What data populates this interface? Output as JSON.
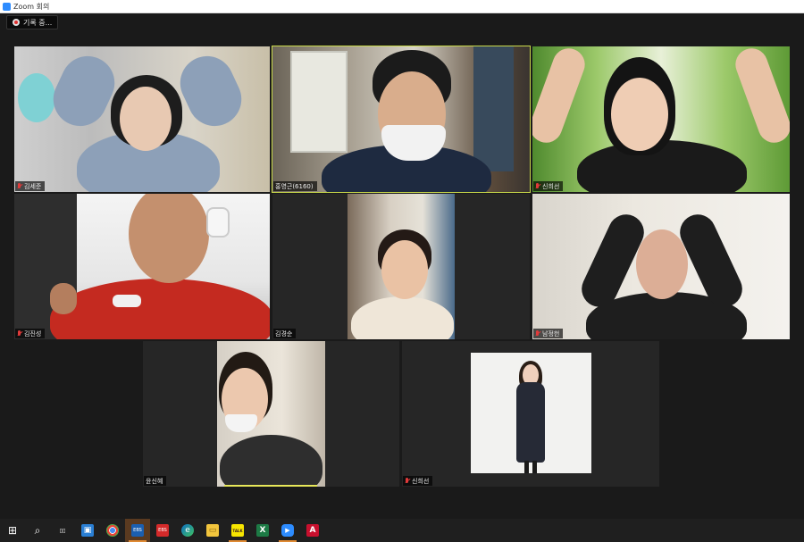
{
  "window": {
    "title": "Zoom 회의"
  },
  "recording": {
    "label": "기록 중..."
  },
  "participants": [
    {
      "name": "김세준",
      "muted": true
    },
    {
      "name": "홍영근(6160)",
      "muted": false,
      "active_speaker": true
    },
    {
      "name": "신희선",
      "muted": true
    },
    {
      "name": "김진성",
      "muted": true
    },
    {
      "name": "김경순",
      "muted": false
    },
    {
      "name": "남정헌",
      "muted": true
    },
    {
      "name": "윤신혜",
      "muted": false
    },
    {
      "name": "신희선",
      "muted": true
    }
  ],
  "taskbar": {
    "items": [
      {
        "name": "start-icon",
        "glyph": "⊞"
      },
      {
        "name": "search-icon",
        "glyph": "⌕"
      },
      {
        "name": "task-view-icon",
        "glyph": "▯▯"
      },
      {
        "name": "app-blue-icon",
        "glyph": "▣"
      },
      {
        "name": "chrome-icon",
        "glyph": "◉"
      },
      {
        "name": "app-orange-icon",
        "glyph": "EBS"
      },
      {
        "name": "app-red-icon",
        "glyph": "EBS"
      },
      {
        "name": "edge-icon",
        "glyph": "e"
      },
      {
        "name": "file-explorer-icon",
        "glyph": "▭"
      },
      {
        "name": "kakaotalk-icon",
        "glyph": "TALK"
      },
      {
        "name": "excel-icon",
        "glyph": "X"
      },
      {
        "name": "zoom-icon",
        "glyph": "▶"
      },
      {
        "name": "acrobat-icon",
        "glyph": "A"
      }
    ]
  },
  "colors": {
    "active_speaker_border": "#c9d94a",
    "muted_mic": "#e03a3a",
    "zoom_blue": "#2d8cff"
  }
}
